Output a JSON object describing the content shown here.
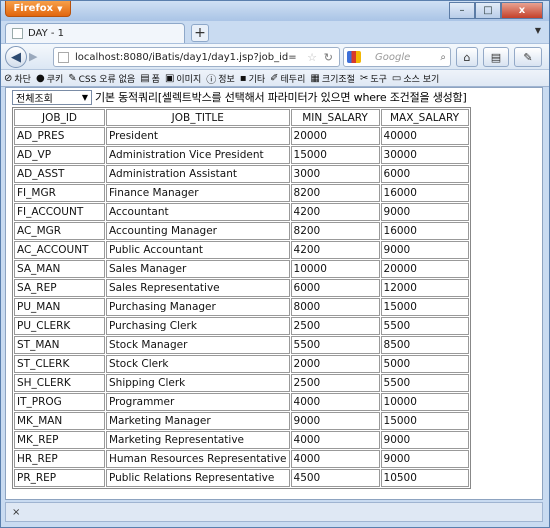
{
  "browser": {
    "app_button": "Firefox",
    "tab_title": "DAY - 1",
    "url": "localhost:8080/iBatis/day1/day1.jsp?job_id=",
    "search_placeholder": "Google"
  },
  "window_controls": {
    "minimize": "–",
    "maximize": "□",
    "close": "x"
  },
  "toolbar_items": [
    {
      "icon": "block-icon",
      "label": "차단"
    },
    {
      "icon": "person-icon",
      "label": "쿠키"
    },
    {
      "icon": "pencil-icon",
      "label": "CSS 오류 없음"
    },
    {
      "icon": "form-icon",
      "label": "폼"
    },
    {
      "icon": "image-icon",
      "label": "이미지"
    },
    {
      "icon": "info-icon",
      "label": "정보"
    },
    {
      "icon": "misc-icon",
      "label": "기타"
    },
    {
      "icon": "outline-icon",
      "label": "테두리"
    },
    {
      "icon": "resize-icon",
      "label": "크기조절"
    },
    {
      "icon": "tools-icon",
      "label": "도구"
    },
    {
      "icon": "source-icon",
      "label": "소스 보기"
    }
  ],
  "page": {
    "select_value": "전체조회",
    "description": "기본 동적쿼리[셀렉트박스를 선택해서 파라미터가 있으면 where 조건절을 생성함]"
  },
  "table": {
    "headers": [
      "JOB_ID",
      "JOB_TITLE",
      "MIN_SALARY",
      "MAX_SALARY"
    ],
    "rows": [
      [
        "AD_PRES",
        "President",
        "20000",
        "40000"
      ],
      [
        "AD_VP",
        "Administration Vice President",
        "15000",
        "30000"
      ],
      [
        "AD_ASST",
        "Administration Assistant",
        "3000",
        "6000"
      ],
      [
        "FI_MGR",
        "Finance Manager",
        "8200",
        "16000"
      ],
      [
        "FI_ACCOUNT",
        "Accountant",
        "4200",
        "9000"
      ],
      [
        "AC_MGR",
        "Accounting Manager",
        "8200",
        "16000"
      ],
      [
        "AC_ACCOUNT",
        "Public Accountant",
        "4200",
        "9000"
      ],
      [
        "SA_MAN",
        "Sales Manager",
        "10000",
        "20000"
      ],
      [
        "SA_REP",
        "Sales Representative",
        "6000",
        "12000"
      ],
      [
        "PU_MAN",
        "Purchasing Manager",
        "8000",
        "15000"
      ],
      [
        "PU_CLERK",
        "Purchasing Clerk",
        "2500",
        "5500"
      ],
      [
        "ST_MAN",
        "Stock Manager",
        "5500",
        "8500"
      ],
      [
        "ST_CLERK",
        "Stock Clerk",
        "2000",
        "5000"
      ],
      [
        "SH_CLERK",
        "Shipping Clerk",
        "2500",
        "5500"
      ],
      [
        "IT_PROG",
        "Programmer",
        "4000",
        "10000"
      ],
      [
        "MK_MAN",
        "Marketing Manager",
        "9000",
        "15000"
      ],
      [
        "MK_REP",
        "Marketing Representative",
        "4000",
        "9000"
      ],
      [
        "HR_REP",
        "Human Resources Representative",
        "4000",
        "9000"
      ],
      [
        "PR_REP",
        "Public Relations Representative",
        "4500",
        "10500"
      ]
    ]
  },
  "findbar": {
    "close": "×"
  }
}
